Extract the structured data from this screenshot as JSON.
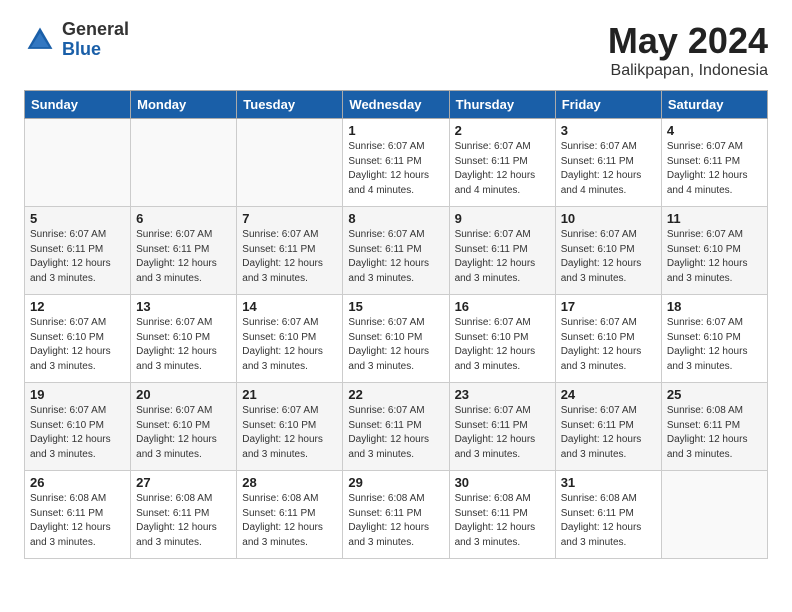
{
  "header": {
    "logo_general": "General",
    "logo_blue": "Blue",
    "title": "May 2024",
    "subtitle": "Balikpapan, Indonesia"
  },
  "days_of_week": [
    "Sunday",
    "Monday",
    "Tuesday",
    "Wednesday",
    "Thursday",
    "Friday",
    "Saturday"
  ],
  "weeks": [
    [
      {
        "day": "",
        "info": ""
      },
      {
        "day": "",
        "info": ""
      },
      {
        "day": "",
        "info": ""
      },
      {
        "day": "1",
        "info": "Sunrise: 6:07 AM\nSunset: 6:11 PM\nDaylight: 12 hours\nand 4 minutes."
      },
      {
        "day": "2",
        "info": "Sunrise: 6:07 AM\nSunset: 6:11 PM\nDaylight: 12 hours\nand 4 minutes."
      },
      {
        "day": "3",
        "info": "Sunrise: 6:07 AM\nSunset: 6:11 PM\nDaylight: 12 hours\nand 4 minutes."
      },
      {
        "day": "4",
        "info": "Sunrise: 6:07 AM\nSunset: 6:11 PM\nDaylight: 12 hours\nand 4 minutes."
      }
    ],
    [
      {
        "day": "5",
        "info": "Sunrise: 6:07 AM\nSunset: 6:11 PM\nDaylight: 12 hours\nand 3 minutes."
      },
      {
        "day": "6",
        "info": "Sunrise: 6:07 AM\nSunset: 6:11 PM\nDaylight: 12 hours\nand 3 minutes."
      },
      {
        "day": "7",
        "info": "Sunrise: 6:07 AM\nSunset: 6:11 PM\nDaylight: 12 hours\nand 3 minutes."
      },
      {
        "day": "8",
        "info": "Sunrise: 6:07 AM\nSunset: 6:11 PM\nDaylight: 12 hours\nand 3 minutes."
      },
      {
        "day": "9",
        "info": "Sunrise: 6:07 AM\nSunset: 6:11 PM\nDaylight: 12 hours\nand 3 minutes."
      },
      {
        "day": "10",
        "info": "Sunrise: 6:07 AM\nSunset: 6:10 PM\nDaylight: 12 hours\nand 3 minutes."
      },
      {
        "day": "11",
        "info": "Sunrise: 6:07 AM\nSunset: 6:10 PM\nDaylight: 12 hours\nand 3 minutes."
      }
    ],
    [
      {
        "day": "12",
        "info": "Sunrise: 6:07 AM\nSunset: 6:10 PM\nDaylight: 12 hours\nand 3 minutes."
      },
      {
        "day": "13",
        "info": "Sunrise: 6:07 AM\nSunset: 6:10 PM\nDaylight: 12 hours\nand 3 minutes."
      },
      {
        "day": "14",
        "info": "Sunrise: 6:07 AM\nSunset: 6:10 PM\nDaylight: 12 hours\nand 3 minutes."
      },
      {
        "day": "15",
        "info": "Sunrise: 6:07 AM\nSunset: 6:10 PM\nDaylight: 12 hours\nand 3 minutes."
      },
      {
        "day": "16",
        "info": "Sunrise: 6:07 AM\nSunset: 6:10 PM\nDaylight: 12 hours\nand 3 minutes."
      },
      {
        "day": "17",
        "info": "Sunrise: 6:07 AM\nSunset: 6:10 PM\nDaylight: 12 hours\nand 3 minutes."
      },
      {
        "day": "18",
        "info": "Sunrise: 6:07 AM\nSunset: 6:10 PM\nDaylight: 12 hours\nand 3 minutes."
      }
    ],
    [
      {
        "day": "19",
        "info": "Sunrise: 6:07 AM\nSunset: 6:10 PM\nDaylight: 12 hours\nand 3 minutes."
      },
      {
        "day": "20",
        "info": "Sunrise: 6:07 AM\nSunset: 6:10 PM\nDaylight: 12 hours\nand 3 minutes."
      },
      {
        "day": "21",
        "info": "Sunrise: 6:07 AM\nSunset: 6:10 PM\nDaylight: 12 hours\nand 3 minutes."
      },
      {
        "day": "22",
        "info": "Sunrise: 6:07 AM\nSunset: 6:11 PM\nDaylight: 12 hours\nand 3 minutes."
      },
      {
        "day": "23",
        "info": "Sunrise: 6:07 AM\nSunset: 6:11 PM\nDaylight: 12 hours\nand 3 minutes."
      },
      {
        "day": "24",
        "info": "Sunrise: 6:07 AM\nSunset: 6:11 PM\nDaylight: 12 hours\nand 3 minutes."
      },
      {
        "day": "25",
        "info": "Sunrise: 6:08 AM\nSunset: 6:11 PM\nDaylight: 12 hours\nand 3 minutes."
      }
    ],
    [
      {
        "day": "26",
        "info": "Sunrise: 6:08 AM\nSunset: 6:11 PM\nDaylight: 12 hours\nand 3 minutes."
      },
      {
        "day": "27",
        "info": "Sunrise: 6:08 AM\nSunset: 6:11 PM\nDaylight: 12 hours\nand 3 minutes."
      },
      {
        "day": "28",
        "info": "Sunrise: 6:08 AM\nSunset: 6:11 PM\nDaylight: 12 hours\nand 3 minutes."
      },
      {
        "day": "29",
        "info": "Sunrise: 6:08 AM\nSunset: 6:11 PM\nDaylight: 12 hours\nand 3 minutes."
      },
      {
        "day": "30",
        "info": "Sunrise: 6:08 AM\nSunset: 6:11 PM\nDaylight: 12 hours\nand 3 minutes."
      },
      {
        "day": "31",
        "info": "Sunrise: 6:08 AM\nSunset: 6:11 PM\nDaylight: 12 hours\nand 3 minutes."
      },
      {
        "day": "",
        "info": ""
      }
    ]
  ]
}
